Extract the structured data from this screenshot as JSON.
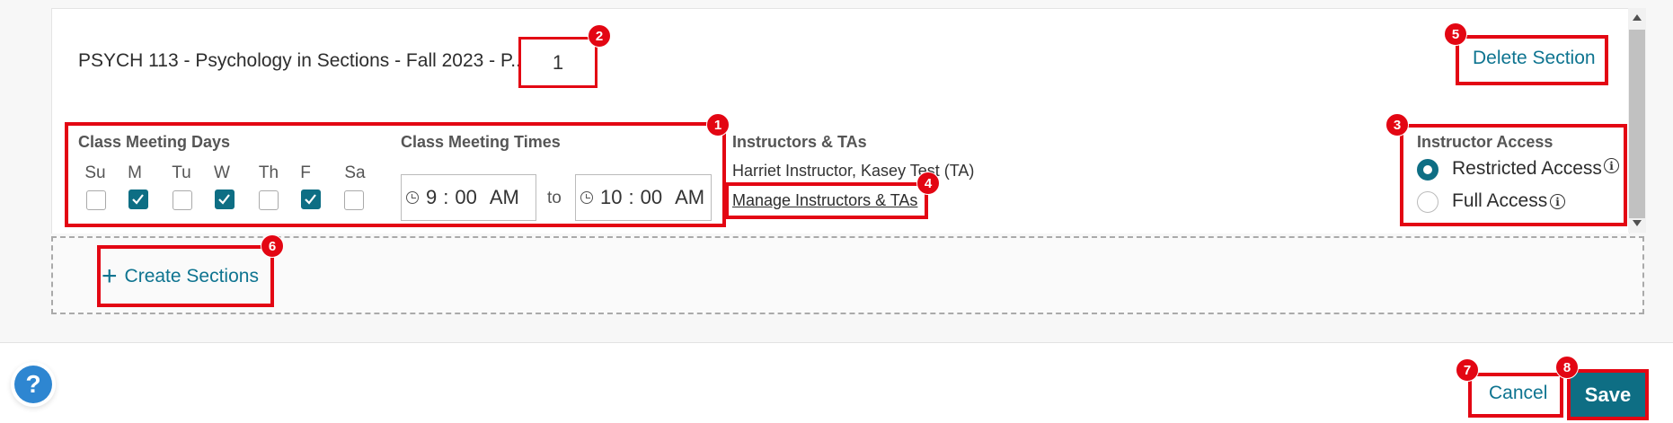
{
  "section": {
    "title": "PSYCH 113 - Psychology in Sections - Fall 2023 - P... -",
    "number": "1",
    "delete_label": "Delete Section"
  },
  "meeting_days": {
    "label": "Class Meeting Days",
    "days": [
      {
        "label": "Su",
        "checked": false
      },
      {
        "label": "M",
        "checked": true
      },
      {
        "label": "Tu",
        "checked": false
      },
      {
        "label": "W",
        "checked": true
      },
      {
        "label": "Th",
        "checked": false
      },
      {
        "label": "F",
        "checked": true
      },
      {
        "label": "Sa",
        "checked": false
      }
    ]
  },
  "meeting_times": {
    "label": "Class Meeting Times",
    "start": {
      "hour": "9",
      "minute": "00",
      "period": "AM"
    },
    "to_label": "to",
    "end": {
      "hour": "10",
      "minute": "00",
      "period": "AM"
    }
  },
  "instructors": {
    "label": "Instructors & TAs",
    "names": "Harriet Instructor, Kasey Test (TA)",
    "manage_label": "Manage Instructors & TAs"
  },
  "access": {
    "label": "Instructor Access",
    "options": [
      {
        "label": "Restricted Access",
        "selected": true
      },
      {
        "label": "Full Access",
        "selected": false
      }
    ]
  },
  "create_sections_label": "Create Sections",
  "footer": {
    "help_label": "?",
    "cancel_label": "Cancel",
    "save_label": "Save"
  },
  "annotations": [
    "1",
    "2",
    "3",
    "4",
    "5",
    "6",
    "7",
    "8"
  ],
  "colors": {
    "accent": "#0e6e84",
    "link": "#0e7490",
    "highlight": "#e30613",
    "help": "#2e86d1"
  }
}
